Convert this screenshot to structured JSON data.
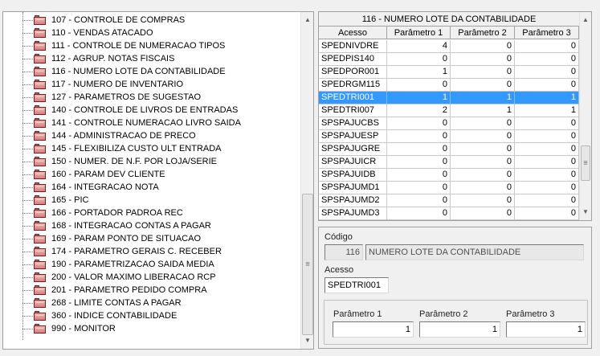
{
  "tree": {
    "items": [
      {
        "label": "107 - CONTROLE DE COMPRAS"
      },
      {
        "label": "110 - VENDAS ATACADO"
      },
      {
        "label": "111 - CONTROLE DE NUMERACAO TIPOS"
      },
      {
        "label": "112 - AGRUP. NOTAS FISCAIS"
      },
      {
        "label": "116 - NUMERO LOTE DA CONTABILIDADE"
      },
      {
        "label": "117 - NUMERO DE INVENTARIO"
      },
      {
        "label": "127 - PARAMETROS DE SUGESTAO"
      },
      {
        "label": "140 - CONTROLE DE LIVROS DE ENTRADAS"
      },
      {
        "label": "141 - CONTROLE NUMERACAO LIVRO SAIDA"
      },
      {
        "label": "144 - ADMINISTRACAO DE PRECO"
      },
      {
        "label": "145 - FLEXIBILIZA CUSTO ULT ENTRADA"
      },
      {
        "label": "150 - NUMER. DE N.F. POR LOJA/SERIE"
      },
      {
        "label": "160 - PARAM DEV CLIENTE"
      },
      {
        "label": "164 - INTEGRACAO NOTA"
      },
      {
        "label": "165 - PIC"
      },
      {
        "label": "166 - PORTADOR PADROA REC"
      },
      {
        "label": "168 - INTEGRACAO CONTAS A PAGAR"
      },
      {
        "label": "169 - PARAM PONTO DE SITUACAO"
      },
      {
        "label": "174 - PARAMETRO GERAIS C. RECEBER"
      },
      {
        "label": "190 - PARAMETRIZACAO SAIDA MEDIA"
      },
      {
        "label": "200 - VALOR MAXIMO LIBERACAO RCP"
      },
      {
        "label": "201 - PARAMETRO PEDIDO COMPRA"
      },
      {
        "label": "268 - LIMITE CONTAS A PAGAR"
      },
      {
        "label": "360 - INDICE CONTABILIDADE"
      },
      {
        "label": "990 - MONITOR"
      }
    ]
  },
  "grid": {
    "title": "116 - NUMERO LOTE DA CONTABILIDADE",
    "columns": [
      "Acesso",
      "Parâmetro 1",
      "Parâmetro 2",
      "Parâmetro 3"
    ],
    "selected_index": 4,
    "rows": [
      [
        "SPEDNIVDRE",
        "4",
        "0",
        "0"
      ],
      [
        "SPEDPIS140",
        "0",
        "0",
        "0"
      ],
      [
        "SPEDPOR001",
        "1",
        "0",
        "0"
      ],
      [
        "SPEDRGM115",
        "0",
        "0",
        "0"
      ],
      [
        "SPEDTRI001",
        "1",
        "1",
        "1"
      ],
      [
        "SPEDTRI007",
        "2",
        "1",
        "1"
      ],
      [
        "SPSPAJUCBS",
        "0",
        "0",
        "0"
      ],
      [
        "SPSPAJUESP",
        "0",
        "0",
        "0"
      ],
      [
        "SPSPAJUGRE",
        "0",
        "0",
        "0"
      ],
      [
        "SPSPAJUICR",
        "0",
        "0",
        "0"
      ],
      [
        "SPSPAJUIDB",
        "0",
        "0",
        "0"
      ],
      [
        "SPSPAJUMD1",
        "0",
        "0",
        "0"
      ],
      [
        "SPSPAJUMD2",
        "0",
        "0",
        "0"
      ],
      [
        "SPSPAJUMD3",
        "0",
        "0",
        "0"
      ]
    ]
  },
  "detail": {
    "codigo_label": "Código",
    "codigo_value": "116",
    "descricao_value": "NUMERO LOTE DA CONTABILIDADE",
    "acesso_label": "Acesso",
    "acesso_value": "SPEDTRI001",
    "param1_label": "Parâmetro 1",
    "param1_value": "1",
    "param2_label": "Parâmetro 2",
    "param2_value": "1",
    "param3_label": "Parâmetro 3",
    "param3_value": "1"
  },
  "icons": {
    "tree_item": "folder-icon",
    "scroll_up": "arrow-up-icon",
    "scroll_down": "arrow-down-icon"
  },
  "colors": {
    "selection": "#3399ff",
    "folder": "#e07b7b"
  }
}
